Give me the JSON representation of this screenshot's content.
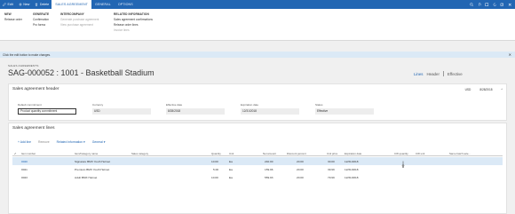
{
  "command_bar": {
    "edit": "Edit",
    "new": "New",
    "delete": "Delete",
    "tabs": [
      "SALES AGREEMENT",
      "GENERAL",
      "OPTIONS"
    ]
  },
  "ribbon": {
    "new": {
      "title": "NEW",
      "items": [
        "Release order"
      ]
    },
    "generate": {
      "title": "GENERATE",
      "items": [
        "Confirmation",
        "Pro forma"
      ]
    },
    "intercompany": {
      "title": "INTERCOMPANY",
      "items": [
        "Generate purchase agreement",
        "View purchase agreement"
      ]
    },
    "related": {
      "title": "RELATED INFORMATION",
      "items": [
        "Sales agreement confirmations",
        "Release order lines",
        "Invoice lines"
      ]
    }
  },
  "infobar": {
    "message": "Click the edit button to make changes.",
    "close": "✕"
  },
  "page": {
    "breadcrumb": "SALES AGREEMENTS",
    "title": "SAG-000052 : 1001 - Basketball Stadium",
    "views": [
      "Lines",
      "Header",
      "Effective"
    ]
  },
  "header_card": {
    "title": "Sales agreement header",
    "currency_summary": "USD",
    "date_summary": "8/28/2018",
    "fields": [
      {
        "label": "Default commitment",
        "value": "Product quantity commitment"
      },
      {
        "label": "Currency",
        "value": "USD"
      },
      {
        "label": "Effective date",
        "value": "8/28/2018"
      },
      {
        "label": "Expiration date",
        "value": "12/31/2018"
      },
      {
        "label": "Status",
        "value": "Effective"
      }
    ]
  },
  "lines_card": {
    "title": "Sales agreement lines",
    "toolbar": {
      "add": "+ Add line",
      "remove": "Remove",
      "related": "Related information ▾",
      "general": "General ▾"
    },
    "columns": [
      "Item number",
      "Item/Category name",
      "Sales category",
      "Quantity",
      "Unit",
      "Net amount",
      "Discount percent",
      "Unit price",
      "Expiration date",
      "CW quantity",
      "CW unit",
      "Same batch sele..."
    ],
    "rows": [
      {
        "item": "0020",
        "name": "Signature BMX Youth Helmet",
        "qty": "10.00",
        "unit": "Ea",
        "net": "240.00",
        "disc": "20.00",
        "price": "30.00",
        "exp": "12/31/2018"
      },
      {
        "item": "0021",
        "name": "Premium BMX Youth Helmet",
        "qty": "5.00",
        "unit": "Ea",
        "net": "159.96",
        "disc": "20.00",
        "price": "39.99",
        "exp": "12/31/2018"
      },
      {
        "item": "0023",
        "name": "Adult BMX Helmet",
        "qty": "10.00",
        "unit": "Ea",
        "net": "559.93",
        "disc": "20.00",
        "price": "79.99",
        "exp": "12/31/2018"
      }
    ]
  },
  "colors": {
    "accent": "#2266b3",
    "info": "#dbe9f6"
  }
}
